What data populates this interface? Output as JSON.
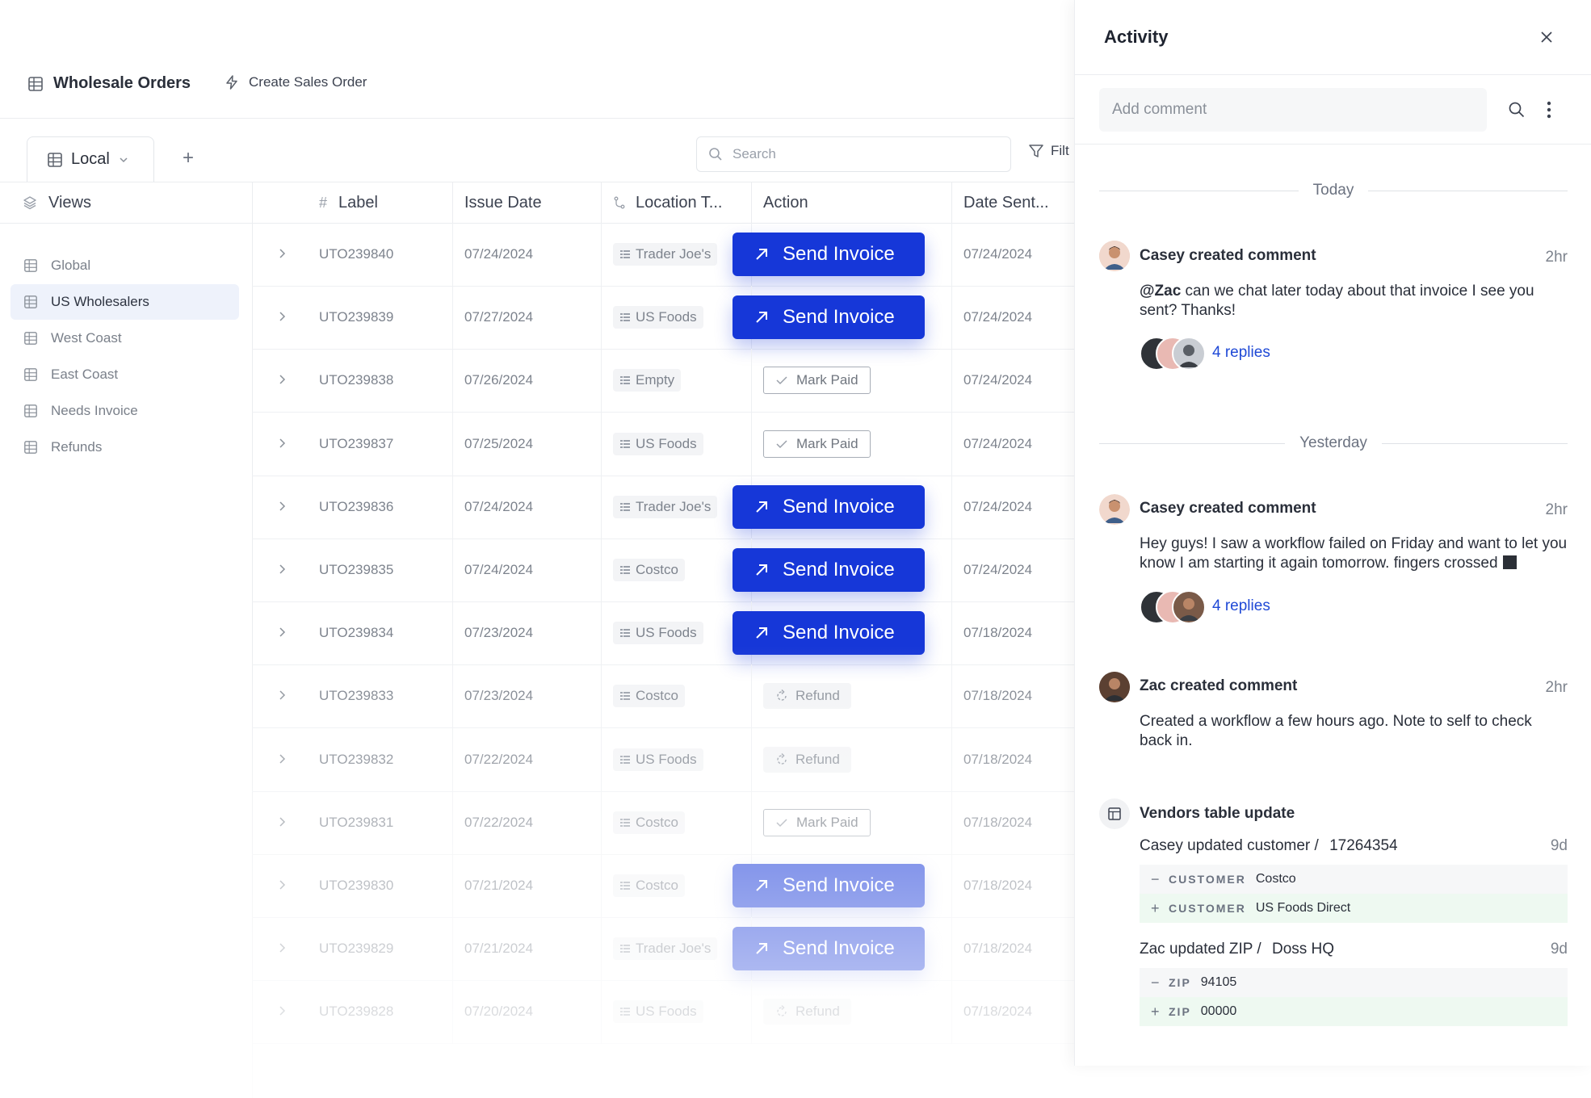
{
  "header": {
    "title": "Wholesale Orders",
    "create_action": "Create Sales Order"
  },
  "tabs": {
    "active_view": "Local",
    "add_label": "+",
    "search_placeholder": "Search",
    "filter_label": "Filt"
  },
  "sidebar": {
    "header": "Views",
    "items": [
      {
        "label": "Global"
      },
      {
        "label": "US Wholesalers",
        "active": true
      },
      {
        "label": "West Coast"
      },
      {
        "label": "East Coast"
      },
      {
        "label": "Needs Invoice"
      },
      {
        "label": "Refunds"
      }
    ]
  },
  "table": {
    "columns": [
      "#",
      "Label",
      "Issue Date",
      "Location T...",
      "Action",
      "Date Sent..."
    ],
    "rows": [
      {
        "label": "UTO239840",
        "issue_date": "07/24/2024",
        "location": "Trader Joe's",
        "action": "Send Invoice",
        "date_sent": "07/24/2024"
      },
      {
        "label": "UTO239839",
        "issue_date": "07/27/2024",
        "location": "US Foods",
        "action": "Send Invoice",
        "date_sent": "07/24/2024"
      },
      {
        "label": "UTO239838",
        "issue_date": "07/26/2024",
        "location": "Empty",
        "action": "Mark Paid",
        "date_sent": "07/24/2024"
      },
      {
        "label": "UTO239837",
        "issue_date": "07/25/2024",
        "location": "US Foods",
        "action": "Mark Paid",
        "date_sent": "07/24/2024"
      },
      {
        "label": "UTO239836",
        "issue_date": "07/24/2024",
        "location": "Trader Joe's",
        "action": "Send Invoice",
        "date_sent": "07/24/2024"
      },
      {
        "label": "UTO239835",
        "issue_date": "07/24/2024",
        "location": "Costco",
        "action": "Send Invoice",
        "date_sent": "07/24/2024"
      },
      {
        "label": "UTO239834",
        "issue_date": "07/23/2024",
        "location": "US Foods",
        "action": "Send Invoice",
        "date_sent": "07/18/2024"
      },
      {
        "label": "UTO239833",
        "issue_date": "07/23/2024",
        "location": "Costco",
        "action": "Refund",
        "date_sent": "07/18/2024"
      },
      {
        "label": "UTO239832",
        "issue_date": "07/22/2024",
        "location": "US Foods",
        "action": "Refund",
        "date_sent": "07/18/2024"
      },
      {
        "label": "UTO239831",
        "issue_date": "07/22/2024",
        "location": "Costco",
        "action": "Mark Paid",
        "date_sent": "07/18/2024"
      },
      {
        "label": "UTO239830",
        "issue_date": "07/21/2024",
        "location": "Costco",
        "action": "Send Invoice",
        "date_sent": "07/18/2024"
      },
      {
        "label": "UTO239829",
        "issue_date": "07/21/2024",
        "location": "Trader Joe's",
        "action": "Send Invoice",
        "date_sent": "07/18/2024"
      },
      {
        "label": "UTO239828",
        "issue_date": "07/20/2024",
        "location": "US Foods",
        "action": "Refund",
        "date_sent": "07/18/2024"
      }
    ]
  },
  "activity": {
    "title": "Activity",
    "comment_placeholder": "Add comment",
    "today_label": "Today",
    "yesterday_label": "Yesterday",
    "entries": [
      {
        "author_action": "Casey created comment",
        "time": "2hr",
        "mention": "@Zac",
        "body": " can we chat later today about that invoice I see you sent? Thanks!",
        "replies": "4 replies"
      },
      {
        "author_action": "Casey created comment",
        "time": "2hr",
        "body": "Hey guys! I saw a workflow failed on Friday and want to let you know I am starting it again tomorrow. fingers crossed",
        "replies": "4 replies"
      },
      {
        "author_action": "Zac created comment",
        "time": "2hr",
        "body": "Created a workflow a few hours ago. Note to self to check back in."
      }
    ],
    "update": {
      "title": "Vendors table update",
      "changes": [
        {
          "summary": "Casey updated customer /",
          "target": "17264354",
          "time": "9d",
          "key": "CUSTOMER",
          "old": "Costco",
          "new": "US Foods Direct"
        },
        {
          "summary": "Zac updated ZIP /",
          "target": "Doss HQ",
          "time": "9d",
          "key": "ZIP",
          "old": "94105",
          "new": "00000"
        }
      ]
    }
  },
  "colors": {
    "accent": "#1637d8",
    "link": "#1f49d6",
    "active_view_bg": "#eef2fb"
  }
}
